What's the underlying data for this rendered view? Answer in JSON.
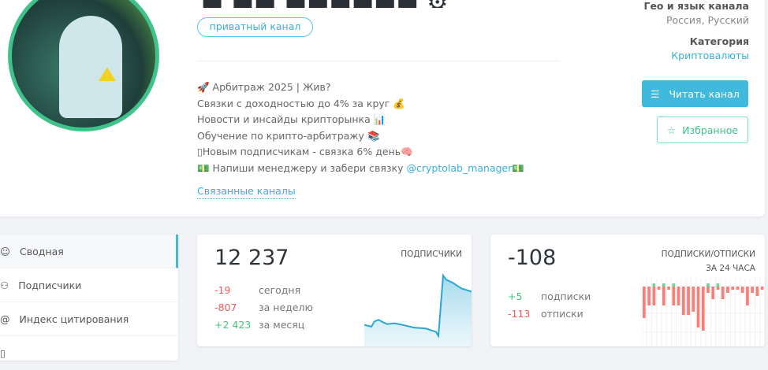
{
  "channel": {
    "type_badge": "приватный канал",
    "description": [
      "Арбитраж 2025 | Жив?",
      "Связки с доходностью до 4% за круг",
      "Новости и инсайды крипторынка",
      "Обучение по крипто-арбитражу",
      "Новым подписчикам - связка 6% день"
    ],
    "manager_prefix": "Напиши менеджеру и забери связку ",
    "manager_link": "@cryptolab_manager",
    "related": "Связанные каналы"
  },
  "meta": {
    "geo_label": "Гео и язык канала",
    "geo_value": "Россия, Русский",
    "category_label": "Категория",
    "category_value": "Криптовалюты"
  },
  "buttons": {
    "read": "Читать канал",
    "favorite": "Избранное"
  },
  "sidebar": {
    "items": [
      {
        "label": "Сводная",
        "icon": "dashboard-icon"
      },
      {
        "label": "Подписчики",
        "icon": "users-icon"
      },
      {
        "label": "Индекс цитирования",
        "icon": "at-icon"
      },
      {
        "label": "",
        "icon": "doc-icon"
      }
    ]
  },
  "subscribers": {
    "total": "12 237",
    "label": "ПОДПИСЧИКИ",
    "today": "-19",
    "today_label": "сегодня",
    "week": "-807",
    "week_label": "за неделю",
    "month": "+2 423",
    "month_label": "за месяц"
  },
  "daily": {
    "total": "-108",
    "label1": "ПОДПИСКИ/ОТПИСКИ",
    "label2": "ЗА 24 ЧАСА",
    "subs": "+5",
    "subs_label": "подписки",
    "unsubs": "-113",
    "unsubs_label": "отписки"
  },
  "colors": {
    "accent": "#40b9dc",
    "green": "#3cc97f",
    "red": "#f05d5d"
  },
  "chart_data": [
    {
      "type": "area",
      "title": "ПОДПИСЧИКИ",
      "values": [
        11700,
        11670,
        11755,
        11780,
        11740,
        11710,
        11725,
        11700,
        11655,
        11640,
        11585,
        11520,
        12500,
        12430,
        12375,
        12290,
        12237
      ],
      "ylim": [
        11350,
        12600
      ]
    },
    {
      "type": "bar",
      "title": "ПОДПИСКИ/ОТПИСКИ ЗА 24 ЧАСА",
      "positive": [
        0,
        0,
        1,
        0,
        1,
        0,
        1,
        0,
        0,
        0,
        0,
        0,
        0,
        1,
        0,
        1,
        0,
        0,
        0,
        0,
        0,
        0,
        0,
        0,
        0
      ],
      "negative": [
        10,
        6,
        6,
        1,
        6,
        1,
        6,
        6,
        9,
        9,
        8,
        13,
        14,
        2,
        4,
        1,
        4,
        2,
        1,
        1,
        2,
        6,
        2,
        3,
        1
      ]
    }
  ]
}
